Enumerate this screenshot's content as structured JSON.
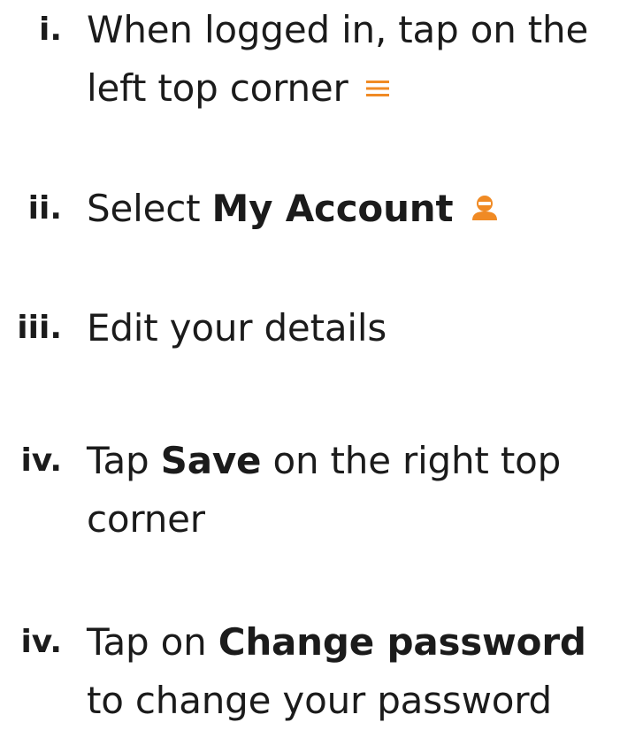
{
  "colors": {
    "accent": "#f08a24",
    "text": "#1b1b1b"
  },
  "steps": [
    {
      "number": "i.",
      "line1": "When logged in, tap on the",
      "line2": "left top corner",
      "icon": "menu-icon"
    },
    {
      "number": "ii.",
      "before": "Select ",
      "bold": "My Account",
      "icon": "account-icon"
    },
    {
      "number": "iii.",
      "text": "Edit your details"
    },
    {
      "number": "iv.",
      "before": "Tap ",
      "bold": "Save",
      "after": " on the right top",
      "line2": "corner"
    },
    {
      "number": "iv.",
      "before": "Tap on ",
      "bold": "Change password",
      "line2": "to change your password"
    }
  ]
}
